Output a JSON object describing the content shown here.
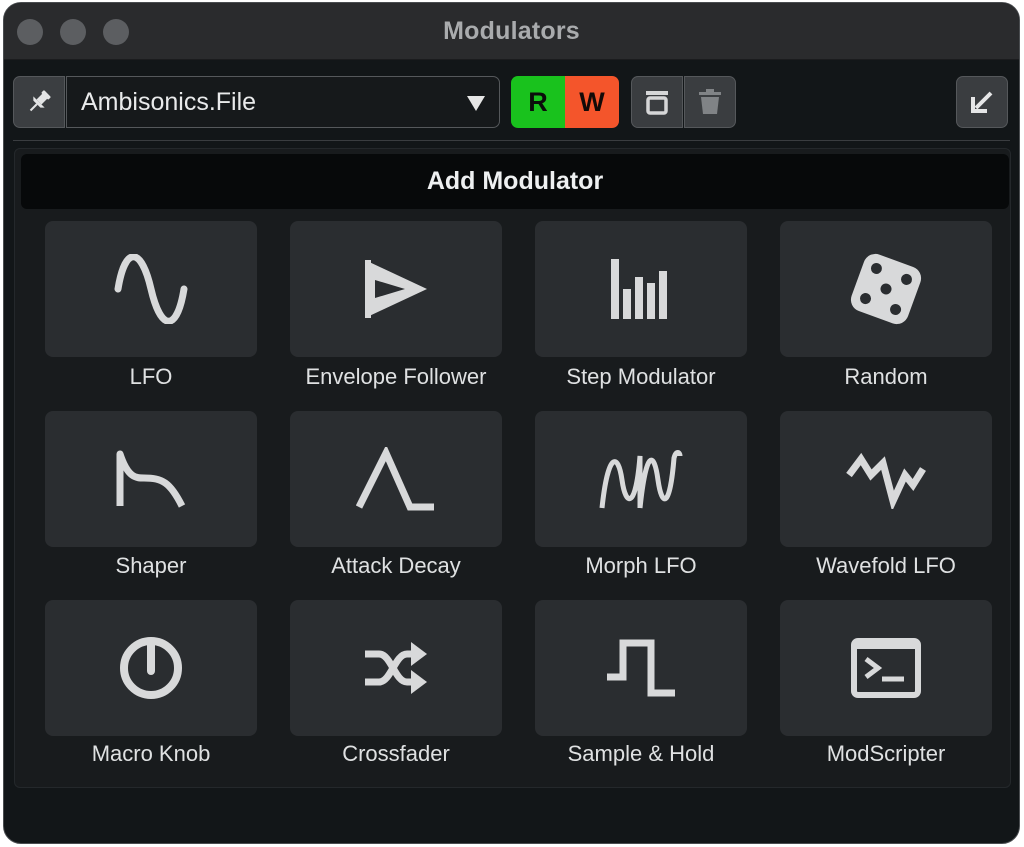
{
  "window": {
    "title": "Modulators"
  },
  "toolbar": {
    "preset_name": "Ambisonics.File",
    "read_label": "R",
    "write_label": "W"
  },
  "panel": {
    "header": "Add Modulator"
  },
  "modulators": [
    {
      "label": "LFO",
      "icon": "sine-wave-icon"
    },
    {
      "label": "Envelope Follower",
      "icon": "envelope-follower-icon"
    },
    {
      "label": "Step Modulator",
      "icon": "step-bars-icon"
    },
    {
      "label": "Random",
      "icon": "dice-icon"
    },
    {
      "label": "Shaper",
      "icon": "shaper-curve-icon"
    },
    {
      "label": "Attack Decay",
      "icon": "attack-decay-icon"
    },
    {
      "label": "Morph LFO",
      "icon": "morph-wave-icon"
    },
    {
      "label": "Wavefold LFO",
      "icon": "wavefold-icon"
    },
    {
      "label": "Macro Knob",
      "icon": "knob-icon"
    },
    {
      "label": "Crossfader",
      "icon": "shuffle-crossfade-icon"
    },
    {
      "label": "Sample & Hold",
      "icon": "square-pulse-icon"
    },
    {
      "label": "ModScripter",
      "icon": "terminal-icon"
    }
  ],
  "colors": {
    "read_green": "#19c21d",
    "write_orange": "#f4552b",
    "tile_bg": "#2a2d30"
  }
}
